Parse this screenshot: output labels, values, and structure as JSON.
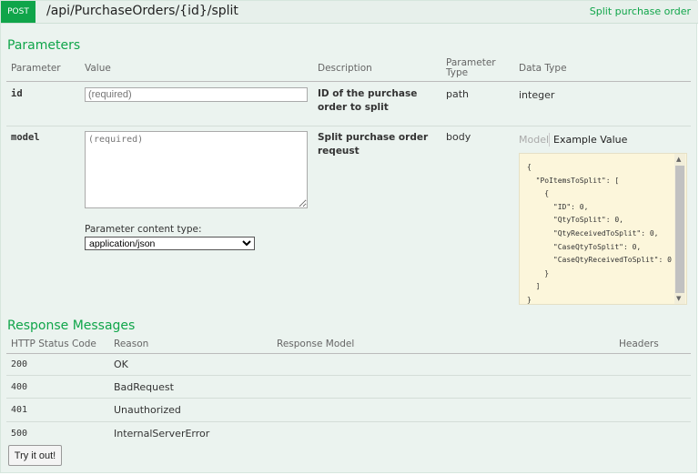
{
  "header": {
    "method": "POST",
    "path": "/api/PurchaseOrders/{id}/split",
    "summary": "Split purchase order"
  },
  "parameters": {
    "title": "Parameters",
    "columns": [
      "Parameter",
      "Value",
      "Description",
      "Parameter Type",
      "Data Type"
    ],
    "rows": [
      {
        "name": "id",
        "placeholder": "(required)",
        "description": "ID of the purchase order to split",
        "type": "path",
        "data_type": "integer"
      },
      {
        "name": "model",
        "placeholder": "(required)",
        "description": "Split purchase order reqeust",
        "type": "body"
      }
    ],
    "content_type_label": "Parameter content type:",
    "content_type": "application/json",
    "model_tab": "Model",
    "example_tab": "Example Value",
    "example": "{\n  \"PoItemsToSplit\": [\n    {\n      \"ID\": 0,\n      \"QtyToSplit\": 0,\n      \"QtyReceivedToSplit\": 0,\n      \"CaseQtyToSplit\": 0,\n      \"CaseQtyReceivedToSplit\": 0\n    }\n  ]\n}"
  },
  "responses": {
    "title": "Response Messages",
    "columns": [
      "HTTP Status Code",
      "Reason",
      "Response Model",
      "Headers"
    ],
    "rows": [
      {
        "code": "200",
        "reason": "OK"
      },
      {
        "code": "400",
        "reason": "BadRequest"
      },
      {
        "code": "401",
        "reason": "Unauthorized"
      },
      {
        "code": "500",
        "reason": "InternalServerError"
      }
    ]
  },
  "try_button": "Try it out!"
}
